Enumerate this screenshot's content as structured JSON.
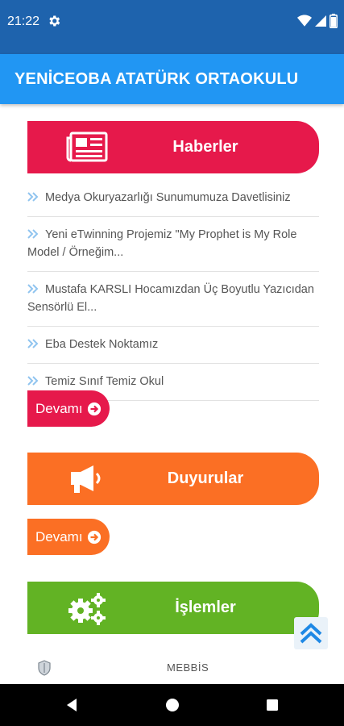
{
  "status_bar": {
    "time": "21:22"
  },
  "app_bar": {
    "title": "YENİCEOBA ATATÜRK ORTAOKULU"
  },
  "sections": {
    "haberler": {
      "title": "Haberler",
      "color": "#e6194b",
      "more_label": "Devamı"
    },
    "duyurular": {
      "title": "Duyurular",
      "color": "#fb6f24",
      "more_label": "Devamı"
    },
    "islemler": {
      "title": "İşlemler",
      "color": "#62b324"
    }
  },
  "news": [
    "Medya Okuryazarlığı Sunumumuza Davetlisiniz",
    "Yeni eTwinning Projemiz \"My Prophet is My Role Model / Örneğim...",
    "Mustafa KARSLI Hocamızdan Üç Boyutlu Yazıcıdan Sensörlü El...",
    "Eba Destek Noktamız",
    "Temiz Sınıf Temiz Okul"
  ],
  "footer": {
    "label": "MEBBİS"
  },
  "icons": {
    "status": [
      "gear-icon",
      "wifi-icon",
      "signal-icon",
      "battery-icon"
    ],
    "sections": [
      "newspaper-icon",
      "megaphone-icon",
      "gears-icon"
    ],
    "nav": [
      "back-icon",
      "home-icon",
      "recents-icon"
    ]
  },
  "colors": {
    "status_bar": "#1e63ad",
    "app_bar": "#2196f3",
    "chevron": "#90c4ef"
  }
}
